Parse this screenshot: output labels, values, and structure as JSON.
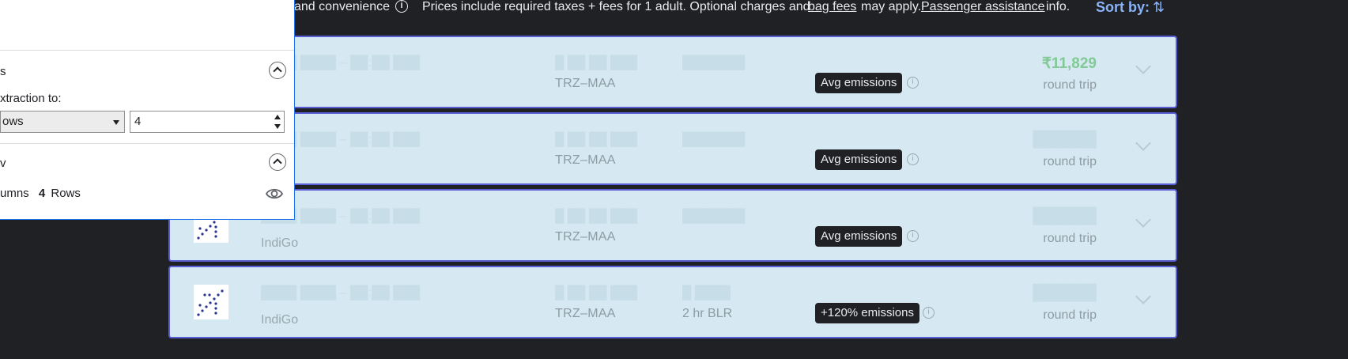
{
  "topbar": {
    "convenience_text": "and convenience",
    "notice_text": "Prices include required taxes + fees for 1 adult. Optional charges and",
    "bag_fees_link": "bag fees",
    "may_apply_text": "may apply.",
    "assistance_link": "Passenger assistance",
    "info_text": "info.",
    "sort_label": "Sort by:"
  },
  "results": [
    {
      "airline": "",
      "route": "TRZ–MAA",
      "stops": "",
      "emissions": "Avg emissions",
      "price": "₹11,829",
      "price_note": "round trip",
      "logo": ""
    },
    {
      "airline": "",
      "route": "TRZ–MAA",
      "stops": "",
      "emissions": "Avg emissions",
      "price": "",
      "price_note": "round trip",
      "logo": ""
    },
    {
      "airline": "IndiGo",
      "route": "TRZ–MAA",
      "stops": "",
      "emissions": "Avg emissions",
      "price": "",
      "price_note": "round trip",
      "logo": "indigo-logo"
    },
    {
      "airline": "IndiGo",
      "route": "TRZ–MAA",
      "stops": "2 hr BLR",
      "emissions": "+120% emissions",
      "price": "",
      "price_note": "round trip",
      "logo": "indigo-logo"
    }
  ],
  "panel": {
    "section1_title": "s",
    "extraction_label": "xtraction to:",
    "select_value": "ows",
    "stepper_value": "4",
    "section2_title": "v",
    "summary_columns": "umns",
    "summary_count": "4",
    "summary_rows": "Rows"
  },
  "colors": {
    "accent": "#8ab4f8",
    "card_bg": "#d6e9f2",
    "card_border": "#5b5fd6",
    "price_green": "#81c995"
  }
}
